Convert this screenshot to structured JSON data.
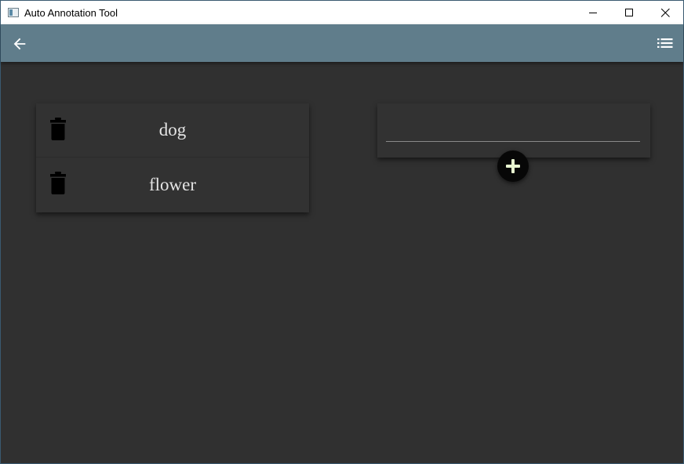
{
  "window": {
    "title": "Auto Annotation Tool",
    "controls": [
      "minimize",
      "maximize",
      "close"
    ]
  },
  "appbar": {
    "color": "#607d8b",
    "left_icon": "arrow-back-icon",
    "right_icon": "format-list-icon"
  },
  "labels": {
    "items": [
      {
        "name": "dog",
        "icon": "trash-icon"
      },
      {
        "name": "flower",
        "icon": "trash-icon"
      }
    ]
  },
  "new_label": {
    "value": "",
    "placeholder": ""
  },
  "add_button": {
    "icon": "plus-icon",
    "accent": "#e8f5d0"
  },
  "colors": {
    "background": "#303030",
    "card": "#323232"
  }
}
